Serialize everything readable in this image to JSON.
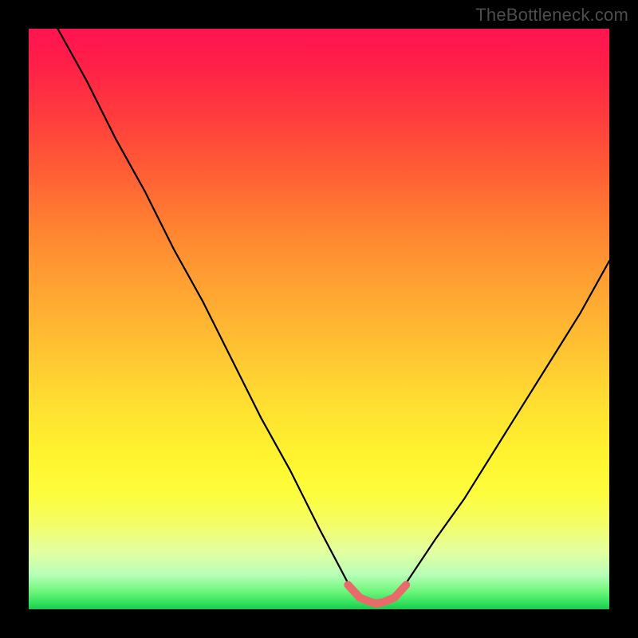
{
  "watermark": "TheBottleneck.com",
  "colors": {
    "frame": "#000000",
    "gradient_top": "#ff1450",
    "gradient_mid_orange": "#ff8531",
    "gradient_mid_yellow": "#ffe031",
    "gradient_bottom": "#18c94e",
    "curve": "#000000",
    "highlight": "#e96a6a"
  },
  "chart_data": {
    "type": "line",
    "title": "",
    "xlabel": "",
    "ylabel": "",
    "xlim": [
      0,
      100
    ],
    "ylim": [
      0,
      100
    ],
    "grid": false,
    "legend": false,
    "series": [
      {
        "name": "bottleneck-curve",
        "x": [
          5,
          10,
          15,
          20,
          25,
          30,
          35,
          40,
          45,
          50,
          55,
          58,
          60,
          62,
          65,
          70,
          75,
          80,
          85,
          90,
          95,
          100
        ],
        "values": [
          100,
          91,
          81,
          72,
          62,
          53,
          43,
          33,
          24,
          14,
          4.5,
          1.5,
          1.0,
          1.5,
          4.5,
          12,
          19,
          27,
          35,
          43,
          51,
          60
        ]
      },
      {
        "name": "target-zone",
        "x": [
          55,
          57,
          59,
          60,
          61,
          63,
          65
        ],
        "values": [
          4.2,
          2.0,
          1.2,
          1.0,
          1.2,
          2.0,
          4.2
        ]
      }
    ],
    "annotations": []
  }
}
